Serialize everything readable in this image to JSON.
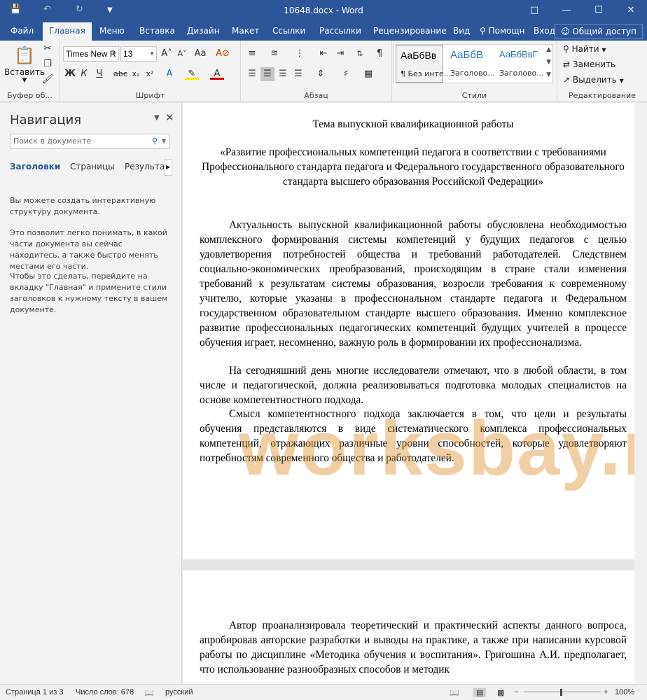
{
  "window": {
    "title": "10648.docx - Word"
  },
  "tabs": [
    "Файл",
    "Главная",
    "Меню",
    "Вставка",
    "Дизайн",
    "Макет",
    "Ссылки",
    "Рассылки",
    "Рецензирование",
    "Вид"
  ],
  "tell_me": "Помощн",
  "signin": "Вход",
  "share": "Общий доступ",
  "ribbon": {
    "clipboard": {
      "paste": "Вставить",
      "label": "Буфер об..."
    },
    "font": {
      "name": "Times New R",
      "size": "13",
      "label": "Шрифт"
    },
    "paragraph": {
      "label": "Абзац"
    },
    "styles": {
      "label": "Стили",
      "items": [
        {
          "preview": "АаБбВв",
          "name": "¶ Без инте..."
        },
        {
          "preview": "АаБбВ",
          "name": "Заголово..."
        },
        {
          "preview": "АаБбВвГ",
          "name": "Заголово..."
        }
      ]
    },
    "editing": {
      "find": "Найти",
      "replace": "Заменить",
      "select": "Выделить",
      "label": "Редактирование"
    }
  },
  "nav": {
    "title": "Навигация",
    "search_placeholder": "Поиск в документе",
    "tabs": [
      "Заголовки",
      "Страницы",
      "Результате"
    ],
    "text1": "Вы можете создать интерактивную структуру документа.",
    "text2": "Это позволит легко понимать, в какой части документа вы сейчас находитесь, а также быстро менять местами его части.",
    "text3": "Чтобы это сделать, перейдите на вкладку \"Главная\" и примените стили заголовков к нужному тексту в вашем документе."
  },
  "document": {
    "title": "Тема выпускной квалификационной работы",
    "subtitle": "«Развитие профессиональных компетенций педагога в соответствии с требованиями Профессионального стандарта педагога и Федерального государственного образовательного стандарта высшего образования Российской Федерации»",
    "para1": "Актуальность выпускной квалификационной работы обусловлена необходимостью комплексного формирования системы компетенций у будущих педагогов с целью удовлетворения потребностей общества и требований работодателей. Следствием социально-экономических преобразований, происходящим в стране стали изменения требований к результатам системы образования, возросли требования к современному учителю, которые указаны в профессиональном стандарте педагога и Федеральном государственном образовательном стандарте высшего образования. Именно комплексное развитие профессиональных педагогических компетенций будущих учителей в процессе обучения играет, несомненно, важную роль в формировании их профессионализма.",
    "para2": "На сегодняшний день многие исследователи отмечают, что в любой области, в том числе и педагогической, должна реализовываться подготовка молодых специалистов на основе компетентностного подхода.",
    "para3": "Смысл компетентностного подхода заключается в том, что цели и результаты обучения представляются в виде систематического комплекса профессиональных компетенций, отражающих различные уровни способностей, которые удовлетворяют потребностям современного общества и работодателей.",
    "para4": "Автор проанализировала теоретический и практический аспекты данного вопроса, апробировав авторские разработки и выводы на практике, а также при написании курсовой работы по дисциплине «Методика обучения и воспитания». Григошина А.И. предполагает, что использование разнообразных способов и методик"
  },
  "watermark": "worksbay.ru",
  "status": {
    "page": "Страница 1 из 3",
    "words": "Число слов: 678",
    "language": "русский",
    "zoom": "100%"
  }
}
